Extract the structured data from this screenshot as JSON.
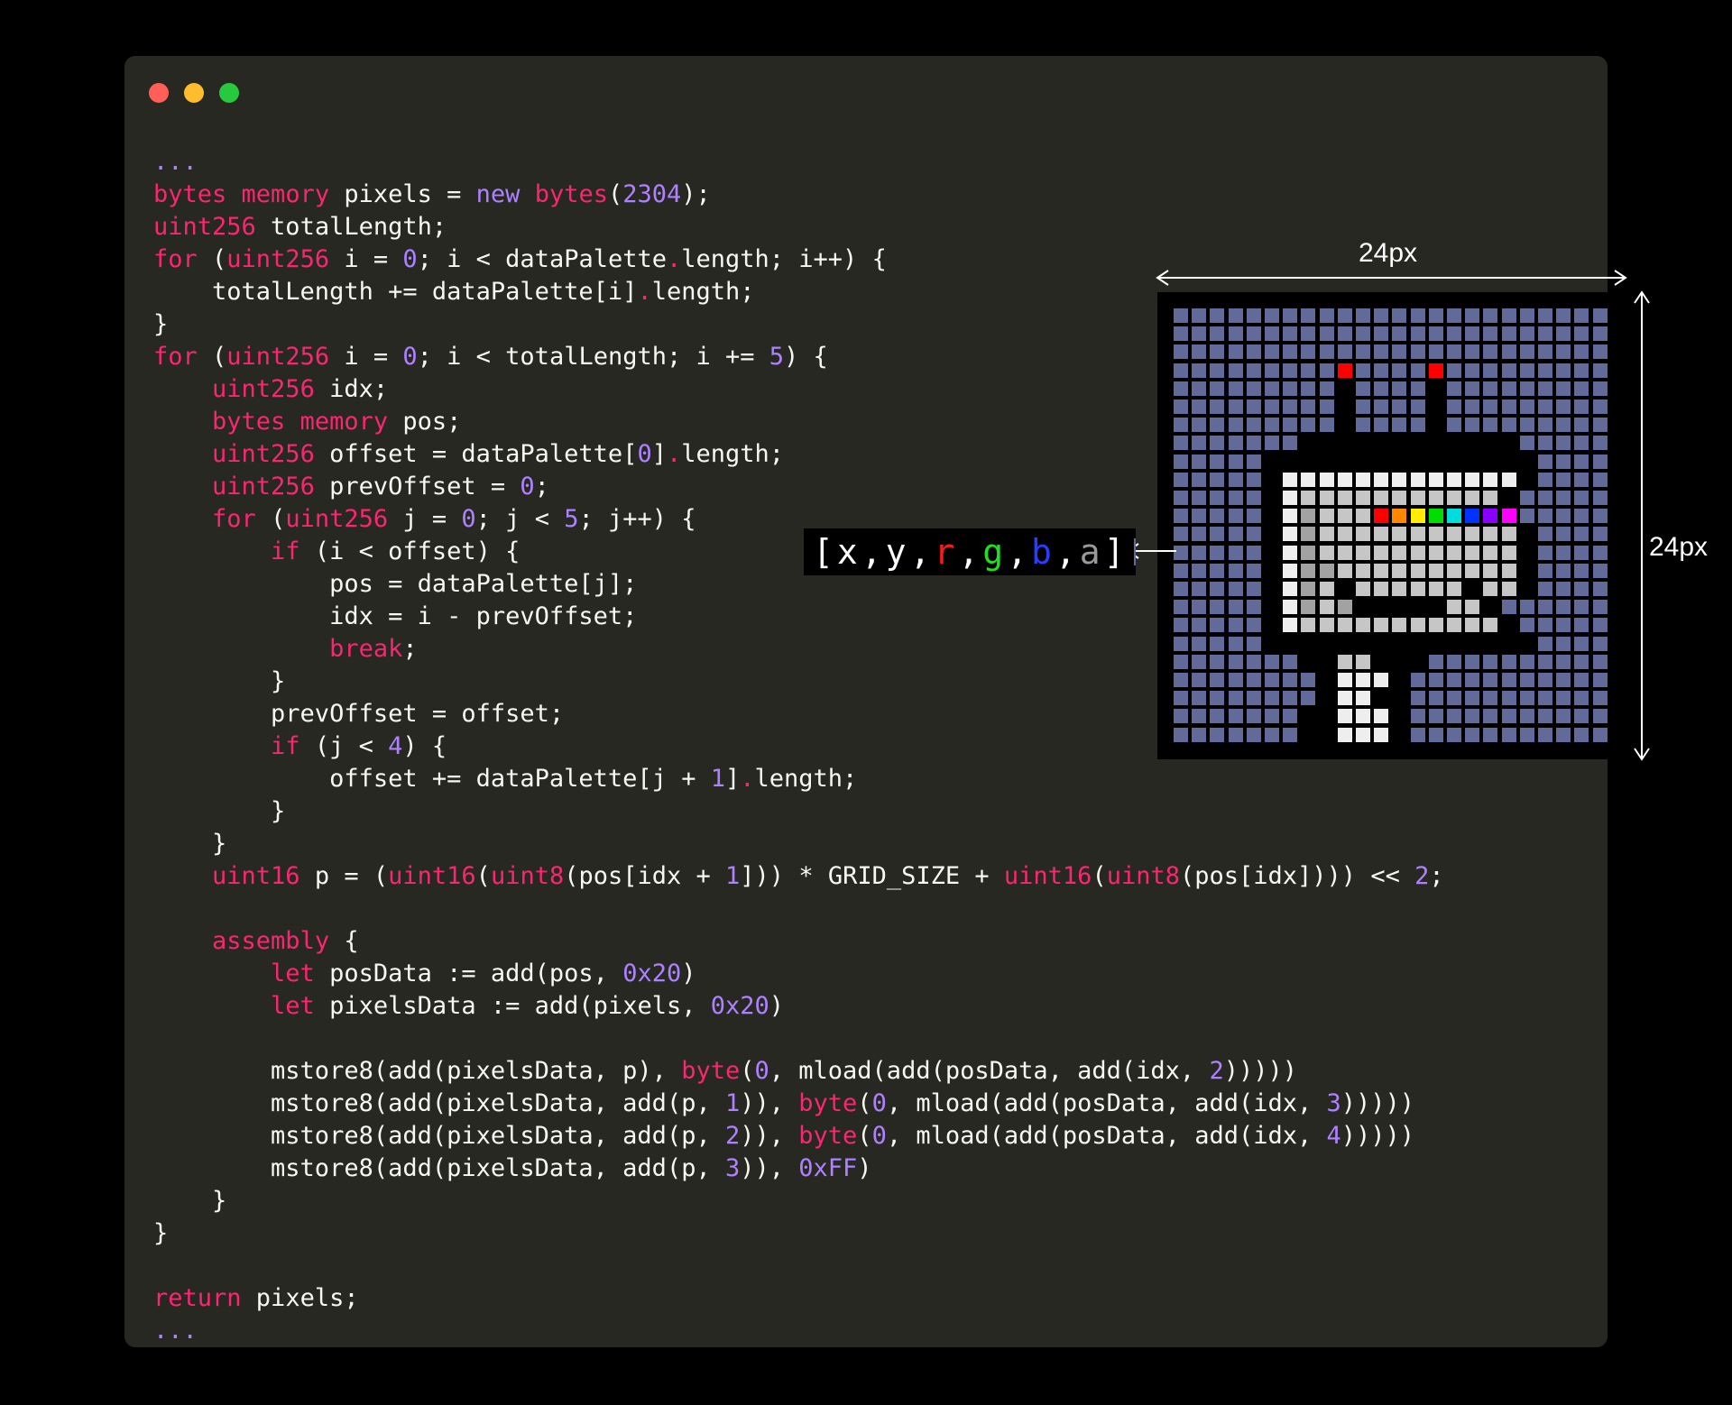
{
  "window": {
    "controls": [
      {
        "name": "close",
        "color": "#ff5f56"
      },
      {
        "name": "minimize",
        "color": "#ffbd2e"
      },
      {
        "name": "zoom",
        "color": "#27c93f"
      }
    ]
  },
  "code": {
    "lines": [
      [
        [
          "...",
          "n"
        ]
      ],
      [
        [
          "bytes",
          "k"
        ],
        [
          " "
        ],
        [
          "memory",
          "k"
        ],
        [
          " pixels = "
        ],
        [
          "new",
          "n"
        ],
        [
          " "
        ],
        [
          "bytes",
          "k"
        ],
        [
          "("
        ],
        [
          "2304",
          "n"
        ],
        [
          ");"
        ]
      ],
      [
        [
          "uint256",
          "k"
        ],
        [
          " totalLength;"
        ]
      ],
      [
        [
          "for",
          "k"
        ],
        [
          " ("
        ],
        [
          "uint256",
          "k"
        ],
        [
          " i = "
        ],
        [
          "0",
          "n"
        ],
        [
          "; i < dataPalette"
        ],
        [
          ".",
          "k"
        ],
        [
          "length; i++) {"
        ]
      ],
      [
        [
          "    totalLength += dataPalette[i]"
        ],
        [
          ".",
          "k"
        ],
        [
          "length;"
        ]
      ],
      [
        [
          "}"
        ]
      ],
      [
        [
          "for",
          "k"
        ],
        [
          " ("
        ],
        [
          "uint256",
          "k"
        ],
        [
          " i = "
        ],
        [
          "0",
          "n"
        ],
        [
          "; i < totalLength; i += "
        ],
        [
          "5",
          "n"
        ],
        [
          ") {"
        ]
      ],
      [
        [
          "    "
        ],
        [
          "uint256",
          "k"
        ],
        [
          " idx;"
        ]
      ],
      [
        [
          "    "
        ],
        [
          "bytes",
          "k"
        ],
        [
          " "
        ],
        [
          "memory",
          "k"
        ],
        [
          " pos;"
        ]
      ],
      [
        [
          "    "
        ],
        [
          "uint256",
          "k"
        ],
        [
          " offset = dataPalette["
        ],
        [
          "0",
          "n"
        ],
        [
          "]"
        ],
        [
          ".",
          "k"
        ],
        [
          "length;"
        ]
      ],
      [
        [
          "    "
        ],
        [
          "uint256",
          "k"
        ],
        [
          " prevOffset = "
        ],
        [
          "0",
          "n"
        ],
        [
          ";"
        ]
      ],
      [
        [
          "    "
        ],
        [
          "for",
          "k"
        ],
        [
          " ("
        ],
        [
          "uint256",
          "k"
        ],
        [
          " j = "
        ],
        [
          "0",
          "n"
        ],
        [
          "; j < "
        ],
        [
          "5",
          "n"
        ],
        [
          "; j++) {"
        ]
      ],
      [
        [
          "        "
        ],
        [
          "if",
          "k"
        ],
        [
          " (i < offset) {"
        ]
      ],
      [
        [
          "            pos = dataPalette[j];"
        ]
      ],
      [
        [
          "            idx = i - prevOffset;"
        ]
      ],
      [
        [
          "            "
        ],
        [
          "break",
          "k"
        ],
        [
          ";"
        ]
      ],
      [
        [
          "        }"
        ]
      ],
      [
        [
          "        prevOffset = offset;"
        ]
      ],
      [
        [
          "        "
        ],
        [
          "if",
          "k"
        ],
        [
          " (j < "
        ],
        [
          "4",
          "n"
        ],
        [
          ") {"
        ]
      ],
      [
        [
          "            offset += dataPalette[j + "
        ],
        [
          "1",
          "n"
        ],
        [
          "]"
        ],
        [
          ".",
          "k"
        ],
        [
          "length;"
        ]
      ],
      [
        [
          "        }"
        ]
      ],
      [
        [
          "    }"
        ]
      ],
      [
        [
          "    "
        ],
        [
          "uint16",
          "k"
        ],
        [
          " p = ("
        ],
        [
          "uint16",
          "k"
        ],
        [
          "("
        ],
        [
          "uint8",
          "k"
        ],
        [
          "(pos[idx + "
        ],
        [
          "1",
          "n"
        ],
        [
          "])) * GRID_SIZE + "
        ],
        [
          "uint16",
          "k"
        ],
        [
          "("
        ],
        [
          "uint8",
          "k"
        ],
        [
          "(pos[idx]))) << "
        ],
        [
          "2",
          "n"
        ],
        [
          ";"
        ]
      ],
      [
        [
          ""
        ]
      ],
      [
        [
          "    "
        ],
        [
          "assembly",
          "k"
        ],
        [
          " {"
        ]
      ],
      [
        [
          "        "
        ],
        [
          "let",
          "k"
        ],
        [
          " posData := add(pos, "
        ],
        [
          "0x20",
          "n"
        ],
        [
          ")"
        ]
      ],
      [
        [
          "        "
        ],
        [
          "let",
          "k"
        ],
        [
          " pixelsData := add(pixels, "
        ],
        [
          "0x20",
          "n"
        ],
        [
          ")"
        ]
      ],
      [
        [
          ""
        ]
      ],
      [
        [
          "        mstore8(add(pixelsData, p), "
        ],
        [
          "byte",
          "k"
        ],
        [
          "("
        ],
        [
          "0",
          "n"
        ],
        [
          ", mload(add(posData, add(idx, "
        ],
        [
          "2",
          "n"
        ],
        [
          "))))) "
        ]
      ],
      [
        [
          "        mstore8(add(pixelsData, add(p, "
        ],
        [
          "1",
          "n"
        ],
        [
          ")), "
        ],
        [
          "byte",
          "k"
        ],
        [
          "("
        ],
        [
          "0",
          "n"
        ],
        [
          ", mload(add(posData, add(idx, "
        ],
        [
          "3",
          "n"
        ],
        [
          "))))) "
        ]
      ],
      [
        [
          "        mstore8(add(pixelsData, add(p, "
        ],
        [
          "2",
          "n"
        ],
        [
          ")), "
        ],
        [
          "byte",
          "k"
        ],
        [
          "("
        ],
        [
          "0",
          "n"
        ],
        [
          ", mload(add(posData, add(idx, "
        ],
        [
          "4",
          "n"
        ],
        [
          "))))) "
        ]
      ],
      [
        [
          "        mstore8(add(pixelsData, add(p, "
        ],
        [
          "3",
          "n"
        ],
        [
          ")), "
        ],
        [
          "0xFF",
          "n"
        ],
        [
          ")"
        ]
      ],
      [
        [
          "    }"
        ]
      ],
      [
        [
          "}"
        ]
      ],
      [
        [
          ""
        ]
      ],
      [
        [
          "return",
          "k"
        ],
        [
          " pixels;"
        ]
      ],
      [
        [
          "...",
          "n"
        ]
      ]
    ]
  },
  "diagram": {
    "width_label": "24px",
    "height_label": "24px",
    "format_tokens": [
      {
        "text": "[",
        "color": "#ffffff"
      },
      {
        "text": "x",
        "color": "#ffffff"
      },
      {
        "text": ",",
        "color": "#ffffff"
      },
      {
        "text": "y",
        "color": "#ffffff"
      },
      {
        "text": ",",
        "color": "#ffffff"
      },
      {
        "text": "r",
        "color": "#ff1a1a"
      },
      {
        "text": ",",
        "color": "#ffffff"
      },
      {
        "text": "g",
        "color": "#22dd22"
      },
      {
        "text": ",",
        "color": "#ffffff"
      },
      {
        "text": "b",
        "color": "#2a3cff"
      },
      {
        "text": ",",
        "color": "#ffffff"
      },
      {
        "text": "a",
        "color": "#9a9a9a"
      },
      {
        "text": "]",
        "color": "#ffffff"
      }
    ],
    "swatch_color": "#626a99",
    "grid_size": 24,
    "palette": {
      "0": "#000000",
      "b": "#626a99",
      "w": "#eeeeee",
      "l": "#c6c6c6",
      "g": "#a2a2a2",
      "R": "#ff0000",
      "1": "#ff0000",
      "2": "#ff8800",
      "3": "#ffee00",
      "4": "#00dd00",
      "5": "#00dddd",
      "6": "#0033ff",
      "7": "#8800ff",
      "8": "#ff00ff"
    },
    "rows": [
      "bbbbbbbbbbbbbbbbbbbbbbbb",
      "bbbbbbbbbbbbbbbbbbbbbbbb",
      "bbbbbbbbbbbbbbbbbbbbbbbb",
      "bbbbbbbbbRbbbbRbbbbbbbbb",
      "bbbbbbbbb0bbbb0bbbbbbbbb",
      "bbbbbbbbb0bbbb0bbbbbbbbb",
      "bbbbbbbbb0bbbb0bbbbbbbbb",
      "bbbbbbb000000000000bbbbb",
      "bbbbb000000000000000bbbb",
      "bbbbb0wwwwwwwwwwwww0bbbb",
      "bbbbb0wlllllllllll0bbbbb",
      "bbbbb0wglll12345678bbbbb",
      "bbbbb0wglllllllllll0bbbb",
      "bbbbb0wglllllllllll0bbbb",
      "bbbbb0wggllllllllll0bbbb",
      "bbbbb0wgl0llllll0ll0bbbb",
      "bbbbb0wglg00000ll0bbbbbb",
      "bbbbb0wlllllllllll0bbbbb",
      "bbbbb000000000000000bbbb",
      "bbbbbbb00ll000bbbbbbbbbb",
      "bbbbbbbb0www0bbbbbbbbbbb",
      "bbbbbbbb0ww00bbbbbbbbbbb",
      "bbbbbbb00www0bbbbbbbbbbb",
      "bbbbbbb00www0bbbbbbbbbbb"
    ]
  }
}
